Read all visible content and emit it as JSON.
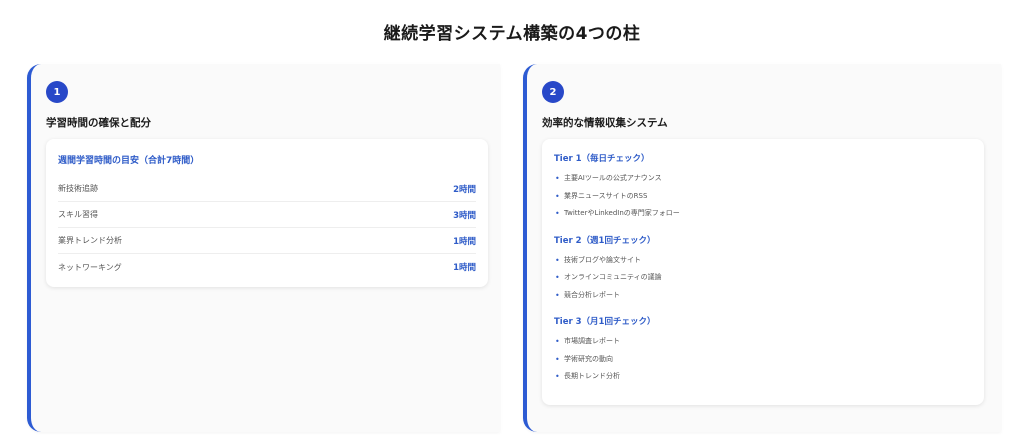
{
  "title": "継続学習システム構築の4つの柱",
  "pillars": [
    {
      "number": "1",
      "heading": "学習時間の確保と配分",
      "card_heading": "週間学習時間の目安（合計7時間）",
      "rows": [
        {
          "label": "新技術追跡",
          "value": "2時間"
        },
        {
          "label": "スキル習得",
          "value": "3時間"
        },
        {
          "label": "業界トレンド分析",
          "value": "1時間"
        },
        {
          "label": "ネットワーキング",
          "value": "1時間"
        }
      ]
    },
    {
      "number": "2",
      "heading": "効率的な情報収集システム",
      "tiers": [
        {
          "heading": "Tier 1（毎日チェック）",
          "items": [
            "主要AIツールの公式アナウンス",
            "業界ニュースサイトのRSS",
            "TwitterやLinkedInの専門家フォロー"
          ]
        },
        {
          "heading": "Tier 2（週1回チェック）",
          "items": [
            "技術ブログや論文サイト",
            "オンラインコミュニティの議論",
            "競合分析レポート"
          ]
        },
        {
          "heading": "Tier 3（月1回チェック）",
          "items": [
            "市場調査レポート",
            "学術研究の動向",
            "長期トレンド分析"
          ]
        }
      ]
    }
  ]
}
